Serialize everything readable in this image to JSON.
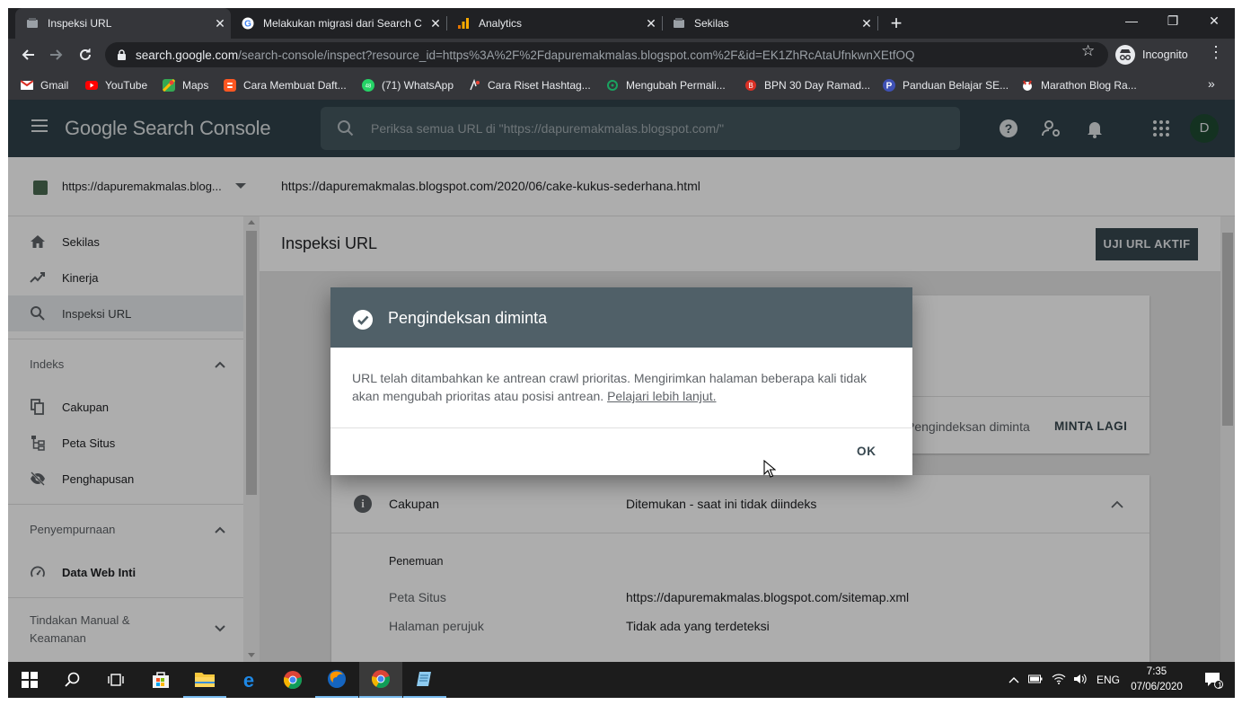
{
  "browser": {
    "tabs": [
      {
        "title": "Inspeksi URL",
        "active": true
      },
      {
        "title": "Melakukan migrasi dari Search C",
        "active": false
      },
      {
        "title": "Analytics",
        "active": false
      },
      {
        "title": "Sekilas",
        "active": false
      }
    ],
    "address": {
      "host": "search.google.com",
      "path": "/search-console/inspect?resource_id=https%3A%2F%2Fdapuremakmalas.blogspot.com%2F&id=EK1ZhRcAtaUfnkwnXEtfOQ"
    },
    "incognito_label": "Incognito",
    "bookmarks": [
      {
        "label": "Gmail",
        "icon": "gmail-icon"
      },
      {
        "label": "YouTube",
        "icon": "youtube-icon"
      },
      {
        "label": "Maps",
        "icon": "maps-icon"
      },
      {
        "label": "Cara Membuat Daft...",
        "icon": "blogger-icon"
      },
      {
        "label": "(71) WhatsApp",
        "icon": "whatsapp-icon"
      },
      {
        "label": "Cara Riset Hashtag...",
        "icon": "link-icon"
      },
      {
        "label": "Mengubah Permali...",
        "icon": "recycle-icon"
      },
      {
        "label": "BPN 30 Day Ramad...",
        "icon": "bpn-icon"
      },
      {
        "label": "Panduan Belajar SE...",
        "icon": "p-icon"
      },
      {
        "label": "Marathon Blog Ra...",
        "icon": "marathon-icon"
      }
    ]
  },
  "app": {
    "title": "Google Search Console",
    "search_placeholder": "Periksa semua URL di \"https://dapuremakmalas.blogspot.com/\"",
    "avatar_letter": "D"
  },
  "sidebar": {
    "property": "https://dapuremakmalas.blog...",
    "items_top": [
      {
        "label": "Sekilas",
        "icon": "home-icon"
      },
      {
        "label": "Kinerja",
        "icon": "trending-up-icon"
      },
      {
        "label": "Inspeksi URL",
        "icon": "search-icon",
        "active": true
      }
    ],
    "section_index": "Indeks",
    "items_index": [
      {
        "label": "Cakupan",
        "icon": "coverage-icon"
      },
      {
        "label": "Peta Situs",
        "icon": "sitemap-icon"
      },
      {
        "label": "Penghapusan",
        "icon": "removal-icon"
      }
    ],
    "section_enhance": "Penyempurnaan",
    "items_enhance": [
      {
        "label": "Data Web Inti",
        "icon": "speedometer-icon"
      }
    ],
    "section_manual": "Tindakan Manual &",
    "section_manual_2": "Keamanan"
  },
  "main": {
    "inspected_url": "https://dapuremakmalas.blogspot.com/2020/06/cake-kukus-sederhana.html",
    "page_title": "Inspeksi URL",
    "live_test_button": "UJI URL AKTIF",
    "indexing_status": "Pengindeksan diminta",
    "request_again_button": "MINTA LAGI",
    "coverage": {
      "label": "Cakupan",
      "value": "Ditemukan - saat ini tidak diindeks",
      "subheading": "Penemuan",
      "rows": [
        {
          "key": "Peta Situs",
          "value": "https://dapuremakmalas.blogspot.com/sitemap.xml"
        },
        {
          "key": "Halaman perujuk",
          "value": "Tidak ada yang terdeteksi"
        }
      ]
    }
  },
  "dialog": {
    "title": "Pengindeksan diminta",
    "body": "URL telah ditambahkan ke antrean crawl prioritas. Mengirimkan halaman beberapa kali tidak akan mengubah prioritas atau posisi antrean.",
    "link": "Pelajari lebih lanjut.",
    "ok_label": "OK"
  },
  "taskbar": {
    "language": "ENG",
    "time": "7:35",
    "date": "07/06/2020",
    "notifications": "1"
  },
  "colors": {
    "header": "#30424b",
    "dialog_header": "#506068",
    "primary_button": "#37474f"
  }
}
